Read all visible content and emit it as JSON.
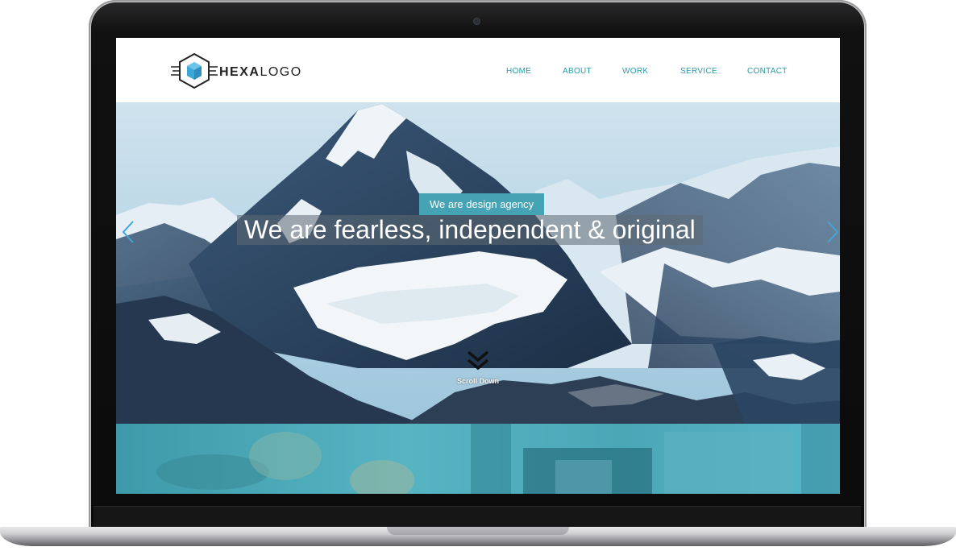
{
  "logo": {
    "bold": "HEXA",
    "light": "LOGO"
  },
  "nav": [
    {
      "label": "HOME"
    },
    {
      "label": "ABOUT"
    },
    {
      "label": "WORK"
    },
    {
      "label": "SERVICE"
    },
    {
      "label": "CONTACT"
    }
  ],
  "hero": {
    "tagline": "We are design agency",
    "headline": "We are fearless, independent & original",
    "scroll_label": "Scroll Down"
  },
  "colors": {
    "accent": "#45a3b3",
    "nav": "#2a9aa6"
  }
}
